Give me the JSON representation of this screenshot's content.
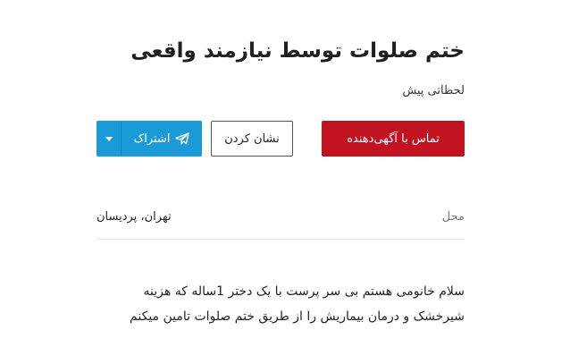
{
  "listing": {
    "title": "ختم صلوات توسط نیازمند واقعی",
    "timestamp": "لحظاتی پیش"
  },
  "actions": {
    "contact_label": "تماس با آگهی‌دهنده",
    "note_label": "نشان کردن",
    "share_label": "اشتراک",
    "share_icon": "telegram-icon",
    "share_menu_icon": "chevron-down-icon"
  },
  "details": {
    "location_label": "محل",
    "location_value": "تهران، پردیسان"
  },
  "description": {
    "lines": [
      "سلام خانومی هستم بی سر پرست با یک دختر 1ساله که هزینه",
      "شیرخشک و درمان بیماریش را از طریق ختم صلوات تامین میکنم"
    ]
  },
  "colors": {
    "contact_button": "#c1121f",
    "share_button": "#1a9ad6"
  }
}
